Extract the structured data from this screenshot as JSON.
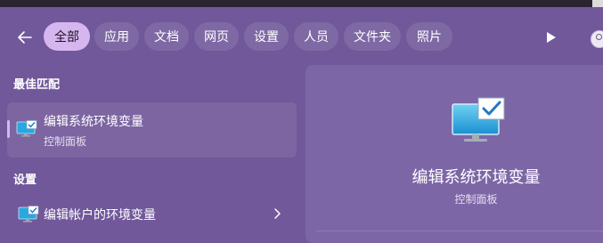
{
  "filters": {
    "tabs": [
      "全部",
      "应用",
      "文档",
      "网页",
      "设置",
      "人员",
      "文件夹",
      "照片"
    ],
    "active_index": 0
  },
  "best_match": {
    "heading": "最佳匹配",
    "item": {
      "title": "编辑系统环境变量",
      "subtitle": "控制面板",
      "icon": "system-properties-icon"
    }
  },
  "settings": {
    "heading": "设置",
    "items": [
      {
        "title": "编辑帐户的环境变量",
        "icon": "system-properties-icon"
      }
    ]
  },
  "preview": {
    "title": "编辑系统环境变量",
    "subtitle": "控制面板",
    "icon": "system-properties-icon"
  },
  "colors": {
    "background": "#71589a",
    "preview_panel": "#7d66a6",
    "active_chip": "#d6b6ee"
  }
}
